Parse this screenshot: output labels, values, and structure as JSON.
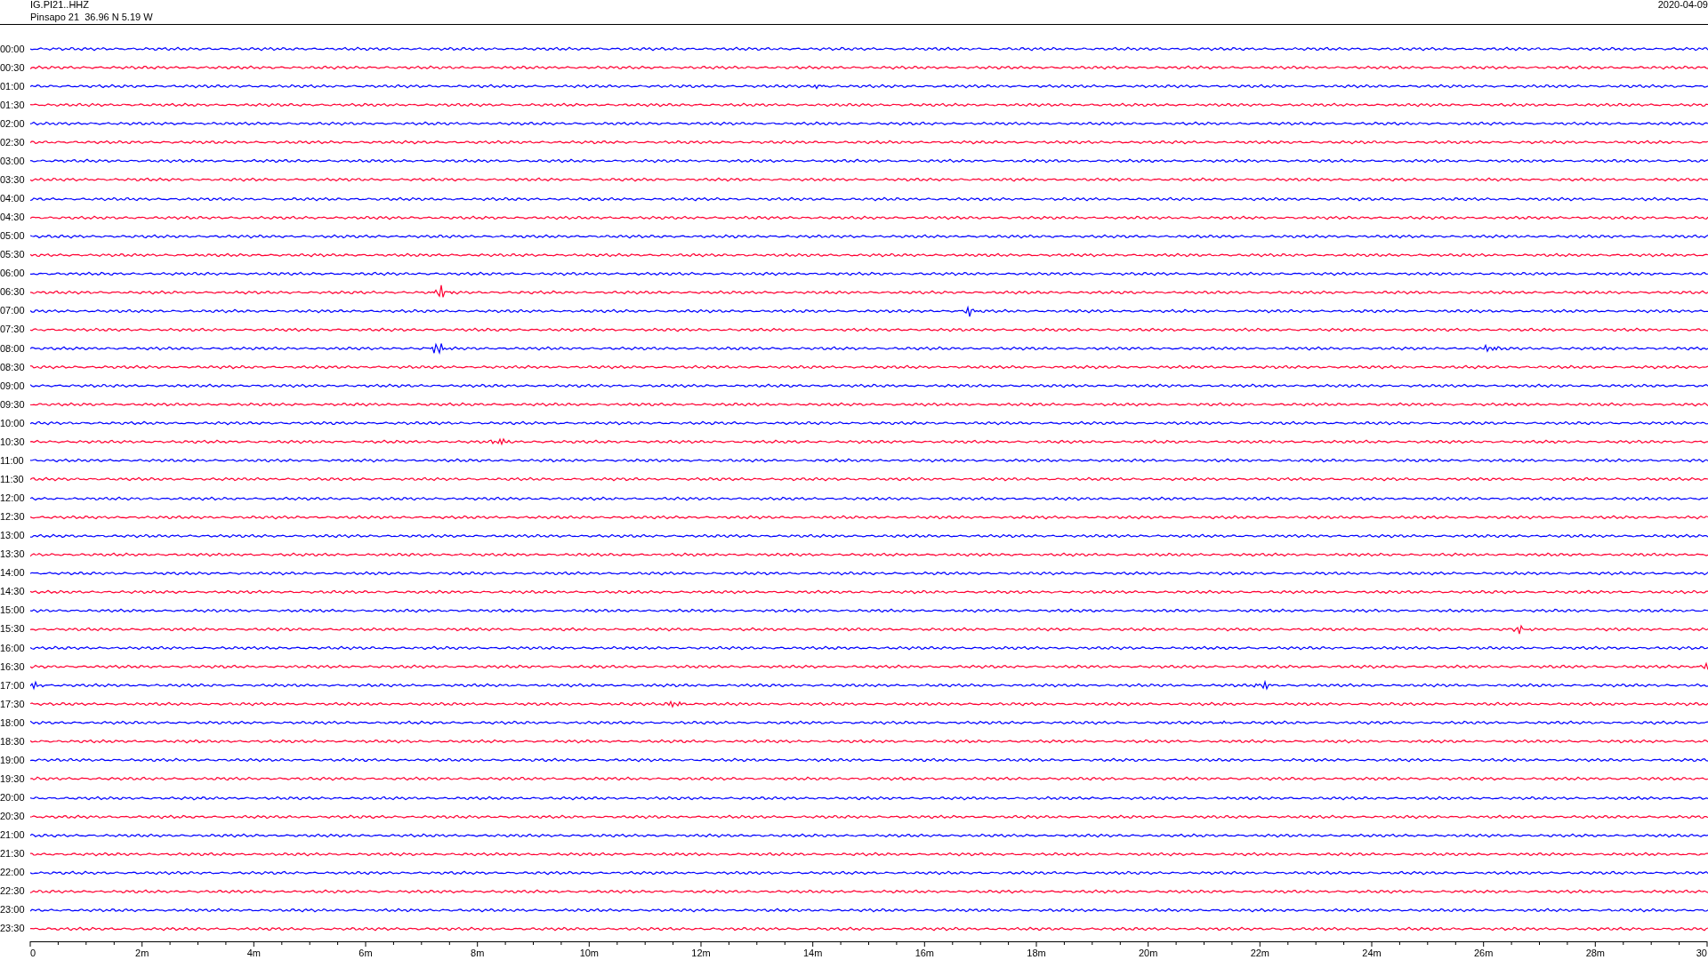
{
  "header": {
    "channel": "IG.PI21..HHZ",
    "station": "Pinsapo 21  36.96 N 5.19 W",
    "date": "2020-04-09"
  },
  "rows": [
    {
      "label": "00:00",
      "color": "#0000ff"
    },
    {
      "label": "00:30",
      "color": "#ff0033"
    },
    {
      "label": "01:00",
      "color": "#0000ff"
    },
    {
      "label": "01:30",
      "color": "#ff0033"
    },
    {
      "label": "02:00",
      "color": "#0000ff"
    },
    {
      "label": "02:30",
      "color": "#ff0033"
    },
    {
      "label": "03:00",
      "color": "#0000ff"
    },
    {
      "label": "03:30",
      "color": "#ff0033"
    },
    {
      "label": "04:00",
      "color": "#0000ff"
    },
    {
      "label": "04:30",
      "color": "#ff0033"
    },
    {
      "label": "05:00",
      "color": "#0000ff"
    },
    {
      "label": "05:30",
      "color": "#ff0033"
    },
    {
      "label": "06:00",
      "color": "#0000ff"
    },
    {
      "label": "06:30",
      "color": "#ff0033"
    },
    {
      "label": "07:00",
      "color": "#0000ff"
    },
    {
      "label": "07:30",
      "color": "#ff0033"
    },
    {
      "label": "08:00",
      "color": "#0000ff"
    },
    {
      "label": "08:30",
      "color": "#ff0033"
    },
    {
      "label": "09:00",
      "color": "#0000ff"
    },
    {
      "label": "09:30",
      "color": "#ff0033"
    },
    {
      "label": "10:00",
      "color": "#0000ff"
    },
    {
      "label": "10:30",
      "color": "#ff0033"
    },
    {
      "label": "11:00",
      "color": "#0000ff"
    },
    {
      "label": "11:30",
      "color": "#ff0033"
    },
    {
      "label": "12:00",
      "color": "#0000ff"
    },
    {
      "label": "12:30",
      "color": "#ff0033"
    },
    {
      "label": "13:00",
      "color": "#0000ff"
    },
    {
      "label": "13:30",
      "color": "#ff0033"
    },
    {
      "label": "14:00",
      "color": "#0000ff"
    },
    {
      "label": "14:30",
      "color": "#ff0033"
    },
    {
      "label": "15:00",
      "color": "#0000ff"
    },
    {
      "label": "15:30",
      "color": "#ff0033"
    },
    {
      "label": "16:00",
      "color": "#0000ff"
    },
    {
      "label": "16:30",
      "color": "#ff0033"
    },
    {
      "label": "17:00",
      "color": "#0000ff"
    },
    {
      "label": "17:30",
      "color": "#ff0033"
    },
    {
      "label": "18:00",
      "color": "#0000ff"
    },
    {
      "label": "18:30",
      "color": "#ff0033"
    },
    {
      "label": "19:00",
      "color": "#0000ff"
    },
    {
      "label": "19:30",
      "color": "#ff0033"
    },
    {
      "label": "20:00",
      "color": "#0000ff"
    },
    {
      "label": "20:30",
      "color": "#ff0033"
    },
    {
      "label": "21:00",
      "color": "#0000ff"
    },
    {
      "label": "21:30",
      "color": "#ff0033"
    },
    {
      "label": "22:00",
      "color": "#0000ff"
    },
    {
      "label": "22:30",
      "color": "#ff0033"
    },
    {
      "label": "23:00",
      "color": "#0000ff"
    },
    {
      "label": "23:30",
      "color": "#ff0033"
    }
  ],
  "x_axis": {
    "labels": [
      "0",
      "2m",
      "4m",
      "6m",
      "8m",
      "10m",
      "12m",
      "14m",
      "16m",
      "18m",
      "20m",
      "22m",
      "24m",
      "26m",
      "28m",
      "30"
    ]
  }
}
